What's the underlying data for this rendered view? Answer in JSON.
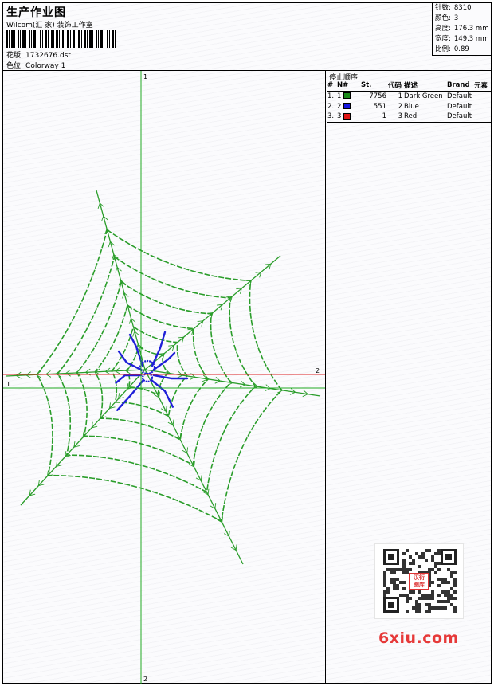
{
  "header": {
    "title": "生产作业图",
    "company": "Wilcom(汇 家) 装饰工作室",
    "pattern_label": "花版:",
    "pattern_value": "1732676.dst",
    "colorway_label": "色位:",
    "colorway_value": "Colorway 1"
  },
  "stats": [
    {
      "label": "针数:",
      "value": "8310"
    },
    {
      "label": "颜色:",
      "value": "3"
    },
    {
      "label": "高度:",
      "value": "176.3 mm"
    },
    {
      "label": "宽度:",
      "value": "149.3 mm"
    },
    {
      "label": "比例:",
      "value": "0.89"
    }
  ],
  "canvas": {
    "v_axis_top_label": "1",
    "v_axis_bottom_label": "2",
    "h_green_label": "1",
    "h_red_label": "2",
    "green": "#22aa22",
    "red": "#dd2222",
    "thread_green": "#2a9d2a",
    "thread_blue": "#1f1fd8"
  },
  "panel": {
    "stop_title": "停止顺序:",
    "columns": [
      "#",
      "N#",
      "St.",
      "代码",
      "描述",
      "Brand",
      "元素"
    ],
    "rows": [
      {
        "idx": "1.",
        "n": "1",
        "color": "#1a8a1a",
        "st": "7756",
        "code": "1",
        "desc": "Dark Green",
        "brand": "Default"
      },
      {
        "idx": "2.",
        "n": "2",
        "color": "#1515e0",
        "st": "551",
        "code": "2",
        "desc": "Blue",
        "brand": "Default"
      },
      {
        "idx": "3.",
        "n": "3",
        "color": "#e01515",
        "st": "1",
        "code": "3",
        "desc": "Red",
        "brand": "Default"
      }
    ]
  },
  "watermark": {
    "badge": "汉衍 图库",
    "site": "6xiu.com"
  }
}
